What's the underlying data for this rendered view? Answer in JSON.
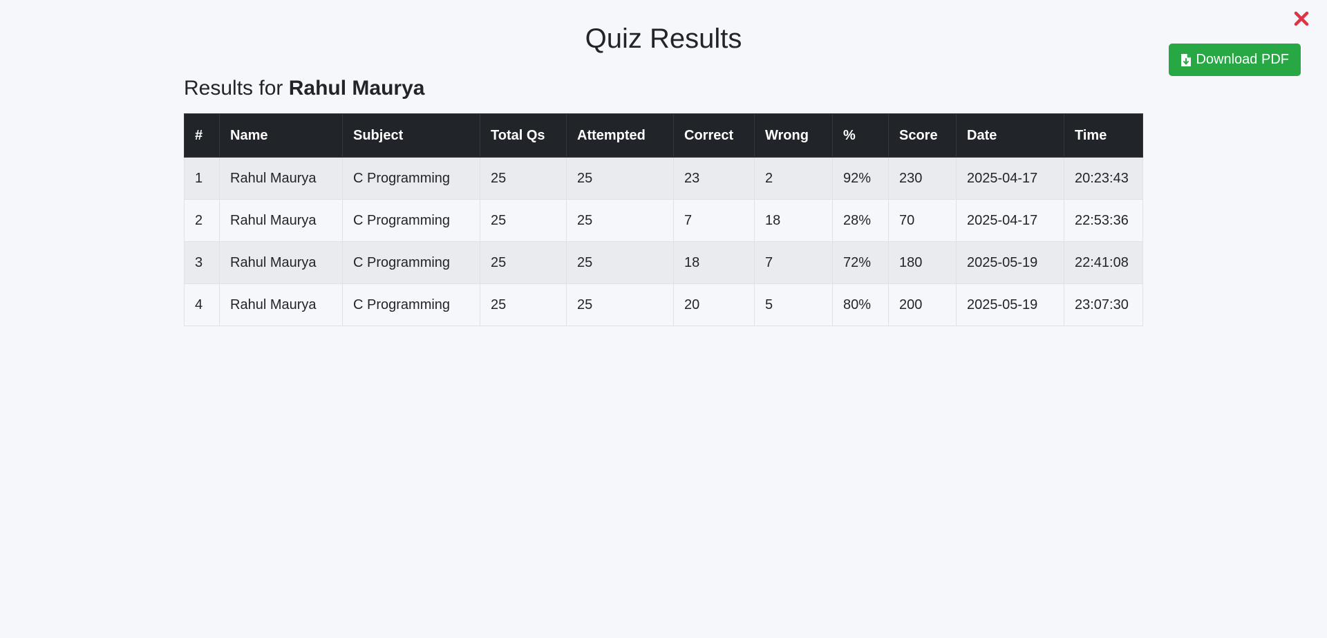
{
  "header": {
    "title": "Quiz Results",
    "close_icon": "close-icon",
    "close_color": "#dc3545"
  },
  "actions": {
    "download_label": "Download PDF",
    "download_icon": "file-download-icon",
    "download_color": "#28a745"
  },
  "results": {
    "heading_prefix": "Results for ",
    "student_name": "Rahul Maurya"
  },
  "table": {
    "columns": [
      "#",
      "Name",
      "Subject",
      "Total Qs",
      "Attempted",
      "Correct",
      "Wrong",
      "%",
      "Score",
      "Date",
      "Time"
    ],
    "rows": [
      [
        "1",
        "Rahul Maurya",
        "C Programming",
        "25",
        "25",
        "23",
        "2",
        "92%",
        "230",
        "2025-04-17",
        "20:23:43"
      ],
      [
        "2",
        "Rahul Maurya",
        "C Programming",
        "25",
        "25",
        "7",
        "18",
        "28%",
        "70",
        "2025-04-17",
        "22:53:36"
      ],
      [
        "3",
        "Rahul Maurya",
        "C Programming",
        "25",
        "25",
        "18",
        "7",
        "72%",
        "180",
        "2025-05-19",
        "22:41:08"
      ],
      [
        "4",
        "Rahul Maurya",
        "C Programming",
        "25",
        "25",
        "20",
        "5",
        "80%",
        "200",
        "2025-05-19",
        "23:07:30"
      ]
    ]
  }
}
